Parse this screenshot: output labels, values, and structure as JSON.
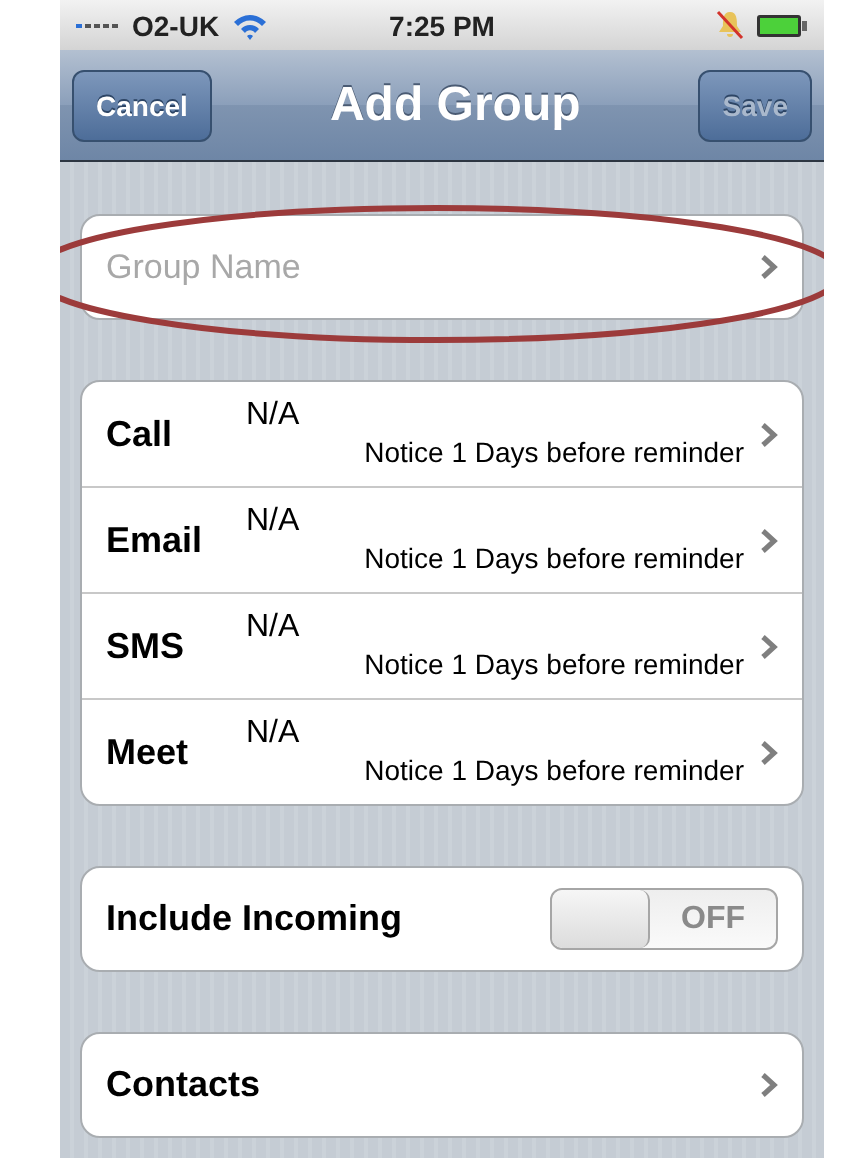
{
  "status_bar": {
    "carrier": "O2-UK",
    "time": "7:25 PM"
  },
  "nav_bar": {
    "title": "Add Group",
    "left_button": "Cancel",
    "right_button": "Save",
    "right_disabled": true
  },
  "group_name": {
    "placeholder": "Group Name",
    "highlighted": true
  },
  "reminders": [
    {
      "label": "Call",
      "value": "N/A",
      "detail": "Notice 1 Days before reminder"
    },
    {
      "label": "Email",
      "value": "N/A",
      "detail": "Notice 1 Days before reminder"
    },
    {
      "label": "SMS",
      "value": "N/A",
      "detail": "Notice 1 Days before reminder"
    },
    {
      "label": "Meet",
      "value": "N/A",
      "detail": "Notice 1 Days before reminder"
    }
  ],
  "include_incoming": {
    "label": "Include Incoming",
    "on": false,
    "state_label": "OFF"
  },
  "contacts": {
    "label": "Contacts"
  }
}
